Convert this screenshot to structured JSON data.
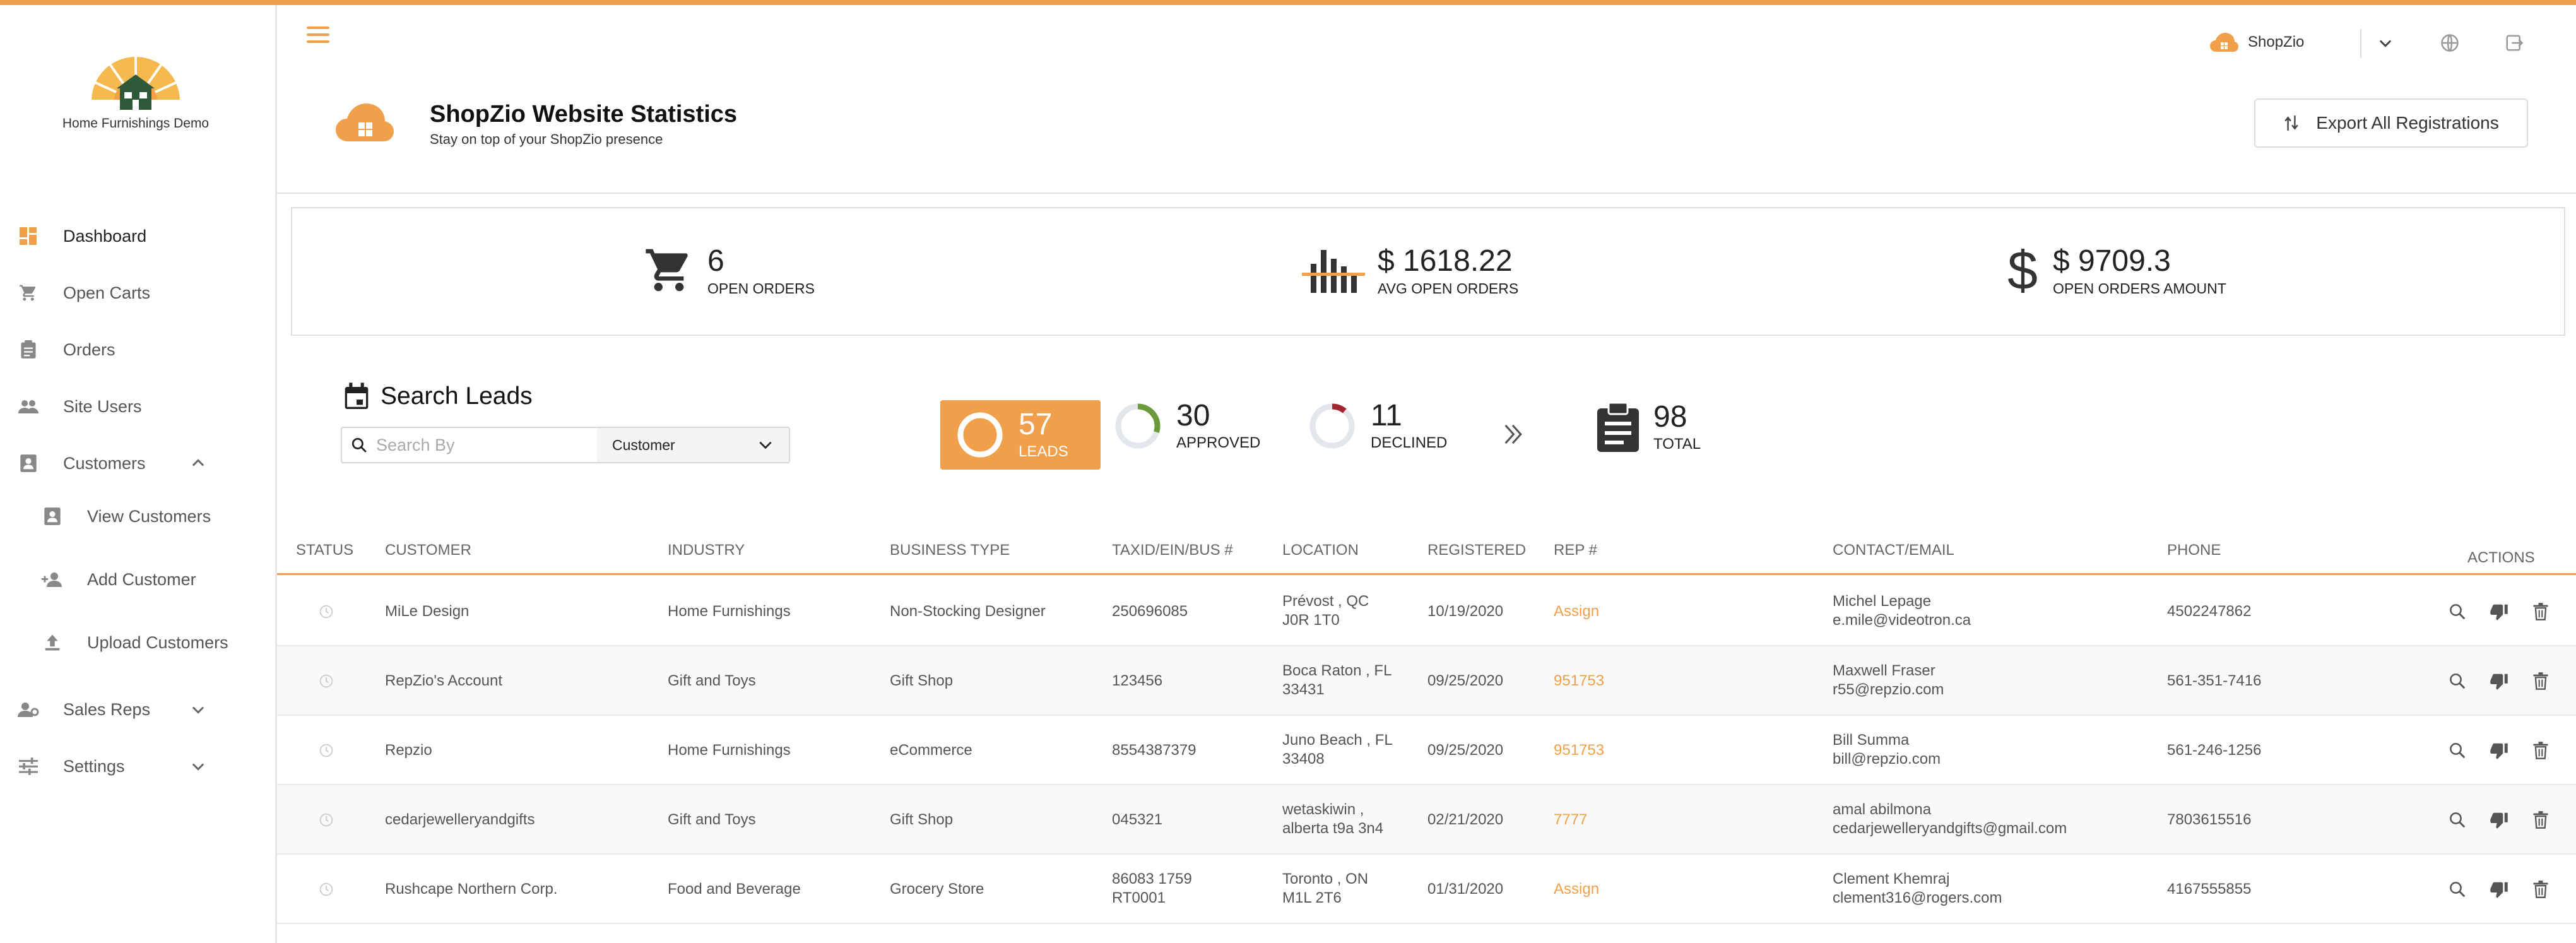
{
  "brand": {
    "logo_text": "Home Furnishings Demo",
    "accent": "#f0a04b"
  },
  "header": {
    "user_brand": "ShopZio",
    "title": "ShopZio Website Statistics",
    "subtitle": "Stay on top of your ShopZio presence",
    "export_label": "Export All Registrations"
  },
  "sidebar": {
    "items": [
      {
        "label": "Dashboard",
        "icon": "dashboard-icon"
      },
      {
        "label": "Open Carts",
        "icon": "cart-icon"
      },
      {
        "label": "Orders",
        "icon": "clipboard-icon"
      },
      {
        "label": "Site Users",
        "icon": "people-icon"
      },
      {
        "label": "Customers",
        "icon": "contact-icon"
      },
      {
        "label": "View Customers",
        "icon": "contact-card-icon"
      },
      {
        "label": "Add Customer",
        "icon": "add-person-icon"
      },
      {
        "label": "Upload Customers",
        "icon": "upload-icon"
      },
      {
        "label": "Sales Reps",
        "icon": "person-gear-icon"
      },
      {
        "label": "Settings",
        "icon": "sliders-icon"
      }
    ]
  },
  "stats": [
    {
      "value": "6",
      "label": "OPEN ORDERS"
    },
    {
      "value": "$ 1618.22",
      "label": "AVG OPEN ORDERS"
    },
    {
      "value": "$ 9709.3",
      "label": "OPEN ORDERS AMOUNT"
    }
  ],
  "search": {
    "title": "Search Leads",
    "placeholder": "Search By",
    "filter": "Customer"
  },
  "leads": [
    {
      "value": "57",
      "label": "LEADS",
      "fraction": 1.0
    },
    {
      "value": "30",
      "label": "APPROVED",
      "fraction": 0.3
    },
    {
      "value": "11",
      "label": "DECLINED",
      "fraction": 0.11
    },
    {
      "value": "98",
      "label": "TOTAL"
    }
  ],
  "table": {
    "columns": [
      "STATUS",
      "CUSTOMER",
      "INDUSTRY",
      "BUSINESS TYPE",
      "TAXID/EIN/BUS #",
      "LOCATION",
      "REGISTERED",
      "REP #",
      "CONTACT/EMAIL",
      "PHONE",
      "ACTIONS"
    ],
    "rows": [
      {
        "customer": "MiLe Design",
        "industry": "Home Furnishings",
        "business_type": "Non-Stocking Designer",
        "taxid": [
          "250696085"
        ],
        "location": [
          "Prévost , QC",
          "J0R 1T0"
        ],
        "registered": "10/19/2020",
        "rep": "Assign",
        "contact": "Michel Lepage",
        "email": "e.mile@videotron.ca",
        "phone": "4502247862"
      },
      {
        "customer": "RepZio's Account",
        "industry": "Gift and Toys",
        "business_type": "Gift Shop",
        "taxid": [
          "123456"
        ],
        "location": [
          "Boca Raton , FL",
          "33431"
        ],
        "registered": "09/25/2020",
        "rep": "951753",
        "contact": "Maxwell Fraser",
        "email": "r55@repzio.com",
        "phone": "561-351-7416"
      },
      {
        "customer": "Repzio",
        "industry": "Home Furnishings",
        "business_type": "eCommerce",
        "taxid": [
          "8554387379"
        ],
        "location": [
          "Juno Beach , FL",
          "33408"
        ],
        "registered": "09/25/2020",
        "rep": "951753",
        "contact": "Bill Summa",
        "email": "bill@repzio.com",
        "phone": "561-246-1256"
      },
      {
        "customer": "cedarjewelleryandgifts",
        "industry": "Gift and Toys",
        "business_type": "Gift Shop",
        "taxid": [
          "045321"
        ],
        "location": [
          "wetaskiwin ,",
          "alberta t9a 3n4"
        ],
        "registered": "02/21/2020",
        "rep": "7777",
        "contact": "amal abilmona",
        "email": "cedarjewelleryandgifts@gmail.com",
        "phone": "7803615516"
      },
      {
        "customer": "Rushcape Northern Corp.",
        "industry": "Food and Beverage",
        "business_type": "Grocery Store",
        "taxid": [
          "86083 1759",
          "RT0001"
        ],
        "location": [
          "Toronto , ON",
          "M1L 2T6"
        ],
        "registered": "01/31/2020",
        "rep": "Assign",
        "contact": "Clement Khemraj",
        "email": "clement316@rogers.com",
        "phone": "4167555855"
      }
    ]
  }
}
